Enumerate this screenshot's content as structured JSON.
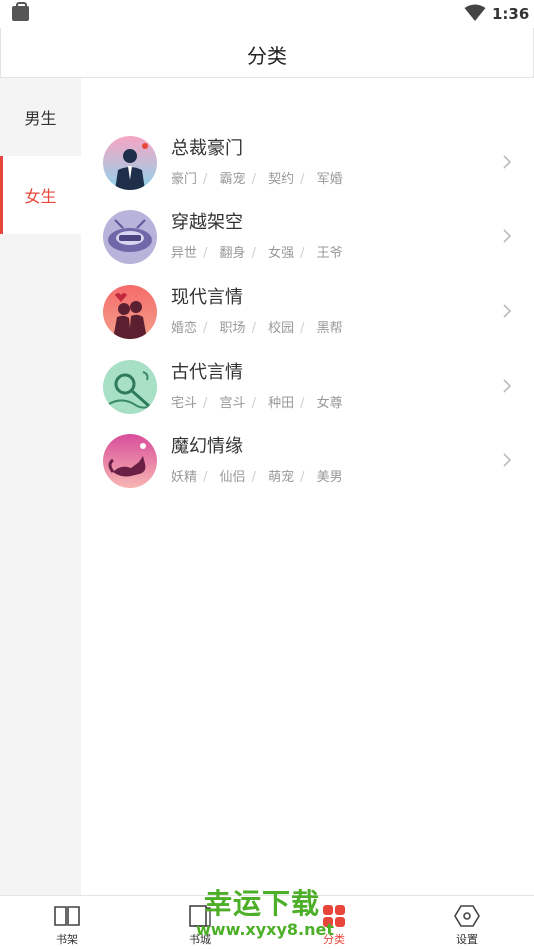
{
  "status_bar": {
    "time": "1:36"
  },
  "header": {
    "title": "分类"
  },
  "sidebar": {
    "tabs": [
      {
        "label": "男生",
        "active": false
      },
      {
        "label": "女生",
        "active": true
      }
    ]
  },
  "categories": [
    {
      "title": "总裁豪门",
      "tags": [
        "豪门",
        "霸宠",
        "契约",
        "军婚"
      ]
    },
    {
      "title": "穿越架空",
      "tags": [
        "异世",
        "翻身",
        "女强",
        "王爷"
      ]
    },
    {
      "title": "现代言情",
      "tags": [
        "婚恋",
        "职场",
        "校园",
        "黑帮"
      ]
    },
    {
      "title": "古代言情",
      "tags": [
        "宅斗",
        "宫斗",
        "种田",
        "女尊"
      ]
    },
    {
      "title": "魔幻情缘",
      "tags": [
        "妖精",
        "仙侣",
        "萌宠",
        "美男"
      ]
    }
  ],
  "bottom_nav": [
    {
      "label": "书架",
      "icon": "book-open-icon",
      "active": false
    },
    {
      "label": "书城",
      "icon": "book-icon",
      "active": false
    },
    {
      "label": "分类",
      "icon": "grid-icon",
      "active": true
    },
    {
      "label": "设置",
      "icon": "hexagon-settings-icon",
      "active": false
    }
  ],
  "watermark": {
    "main": "幸运下载",
    "sub": "www.xyxy8.net"
  },
  "colors": {
    "accent": "#e8463a",
    "sidebar_bg": "#f4f4f4",
    "tag_text": "#999999",
    "watermark": "#4caf27"
  }
}
